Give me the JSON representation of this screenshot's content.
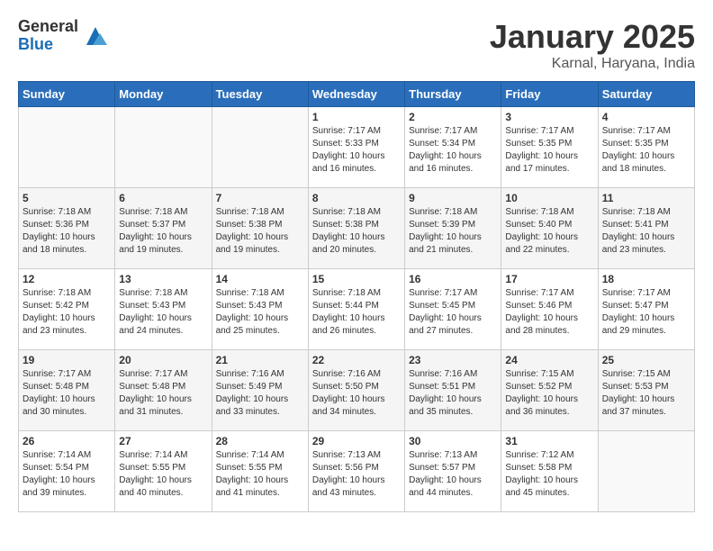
{
  "logo": {
    "general": "General",
    "blue": "Blue"
  },
  "header": {
    "month": "January 2025",
    "location": "Karnal, Haryana, India"
  },
  "weekdays": [
    "Sunday",
    "Monday",
    "Tuesday",
    "Wednesday",
    "Thursday",
    "Friday",
    "Saturday"
  ],
  "weeks": [
    [
      {
        "day": "",
        "sunrise": "",
        "sunset": "",
        "daylight": ""
      },
      {
        "day": "",
        "sunrise": "",
        "sunset": "",
        "daylight": ""
      },
      {
        "day": "",
        "sunrise": "",
        "sunset": "",
        "daylight": ""
      },
      {
        "day": "1",
        "sunrise": "Sunrise: 7:17 AM",
        "sunset": "Sunset: 5:33 PM",
        "daylight": "Daylight: 10 hours and 16 minutes."
      },
      {
        "day": "2",
        "sunrise": "Sunrise: 7:17 AM",
        "sunset": "Sunset: 5:34 PM",
        "daylight": "Daylight: 10 hours and 16 minutes."
      },
      {
        "day": "3",
        "sunrise": "Sunrise: 7:17 AM",
        "sunset": "Sunset: 5:35 PM",
        "daylight": "Daylight: 10 hours and 17 minutes."
      },
      {
        "day": "4",
        "sunrise": "Sunrise: 7:17 AM",
        "sunset": "Sunset: 5:35 PM",
        "daylight": "Daylight: 10 hours and 18 minutes."
      }
    ],
    [
      {
        "day": "5",
        "sunrise": "Sunrise: 7:18 AM",
        "sunset": "Sunset: 5:36 PM",
        "daylight": "Daylight: 10 hours and 18 minutes."
      },
      {
        "day": "6",
        "sunrise": "Sunrise: 7:18 AM",
        "sunset": "Sunset: 5:37 PM",
        "daylight": "Daylight: 10 hours and 19 minutes."
      },
      {
        "day": "7",
        "sunrise": "Sunrise: 7:18 AM",
        "sunset": "Sunset: 5:38 PM",
        "daylight": "Daylight: 10 hours and 19 minutes."
      },
      {
        "day": "8",
        "sunrise": "Sunrise: 7:18 AM",
        "sunset": "Sunset: 5:38 PM",
        "daylight": "Daylight: 10 hours and 20 minutes."
      },
      {
        "day": "9",
        "sunrise": "Sunrise: 7:18 AM",
        "sunset": "Sunset: 5:39 PM",
        "daylight": "Daylight: 10 hours and 21 minutes."
      },
      {
        "day": "10",
        "sunrise": "Sunrise: 7:18 AM",
        "sunset": "Sunset: 5:40 PM",
        "daylight": "Daylight: 10 hours and 22 minutes."
      },
      {
        "day": "11",
        "sunrise": "Sunrise: 7:18 AM",
        "sunset": "Sunset: 5:41 PM",
        "daylight": "Daylight: 10 hours and 23 minutes."
      }
    ],
    [
      {
        "day": "12",
        "sunrise": "Sunrise: 7:18 AM",
        "sunset": "Sunset: 5:42 PM",
        "daylight": "Daylight: 10 hours and 23 minutes."
      },
      {
        "day": "13",
        "sunrise": "Sunrise: 7:18 AM",
        "sunset": "Sunset: 5:43 PM",
        "daylight": "Daylight: 10 hours and 24 minutes."
      },
      {
        "day": "14",
        "sunrise": "Sunrise: 7:18 AM",
        "sunset": "Sunset: 5:43 PM",
        "daylight": "Daylight: 10 hours and 25 minutes."
      },
      {
        "day": "15",
        "sunrise": "Sunrise: 7:18 AM",
        "sunset": "Sunset: 5:44 PM",
        "daylight": "Daylight: 10 hours and 26 minutes."
      },
      {
        "day": "16",
        "sunrise": "Sunrise: 7:17 AM",
        "sunset": "Sunset: 5:45 PM",
        "daylight": "Daylight: 10 hours and 27 minutes."
      },
      {
        "day": "17",
        "sunrise": "Sunrise: 7:17 AM",
        "sunset": "Sunset: 5:46 PM",
        "daylight": "Daylight: 10 hours and 28 minutes."
      },
      {
        "day": "18",
        "sunrise": "Sunrise: 7:17 AM",
        "sunset": "Sunset: 5:47 PM",
        "daylight": "Daylight: 10 hours and 29 minutes."
      }
    ],
    [
      {
        "day": "19",
        "sunrise": "Sunrise: 7:17 AM",
        "sunset": "Sunset: 5:48 PM",
        "daylight": "Daylight: 10 hours and 30 minutes."
      },
      {
        "day": "20",
        "sunrise": "Sunrise: 7:17 AM",
        "sunset": "Sunset: 5:48 PM",
        "daylight": "Daylight: 10 hours and 31 minutes."
      },
      {
        "day": "21",
        "sunrise": "Sunrise: 7:16 AM",
        "sunset": "Sunset: 5:49 PM",
        "daylight": "Daylight: 10 hours and 33 minutes."
      },
      {
        "day": "22",
        "sunrise": "Sunrise: 7:16 AM",
        "sunset": "Sunset: 5:50 PM",
        "daylight": "Daylight: 10 hours and 34 minutes."
      },
      {
        "day": "23",
        "sunrise": "Sunrise: 7:16 AM",
        "sunset": "Sunset: 5:51 PM",
        "daylight": "Daylight: 10 hours and 35 minutes."
      },
      {
        "day": "24",
        "sunrise": "Sunrise: 7:15 AM",
        "sunset": "Sunset: 5:52 PM",
        "daylight": "Daylight: 10 hours and 36 minutes."
      },
      {
        "day": "25",
        "sunrise": "Sunrise: 7:15 AM",
        "sunset": "Sunset: 5:53 PM",
        "daylight": "Daylight: 10 hours and 37 minutes."
      }
    ],
    [
      {
        "day": "26",
        "sunrise": "Sunrise: 7:14 AM",
        "sunset": "Sunset: 5:54 PM",
        "daylight": "Daylight: 10 hours and 39 minutes."
      },
      {
        "day": "27",
        "sunrise": "Sunrise: 7:14 AM",
        "sunset": "Sunset: 5:55 PM",
        "daylight": "Daylight: 10 hours and 40 minutes."
      },
      {
        "day": "28",
        "sunrise": "Sunrise: 7:14 AM",
        "sunset": "Sunset: 5:55 PM",
        "daylight": "Daylight: 10 hours and 41 minutes."
      },
      {
        "day": "29",
        "sunrise": "Sunrise: 7:13 AM",
        "sunset": "Sunset: 5:56 PM",
        "daylight": "Daylight: 10 hours and 43 minutes."
      },
      {
        "day": "30",
        "sunrise": "Sunrise: 7:13 AM",
        "sunset": "Sunset: 5:57 PM",
        "daylight": "Daylight: 10 hours and 44 minutes."
      },
      {
        "day": "31",
        "sunrise": "Sunrise: 7:12 AM",
        "sunset": "Sunset: 5:58 PM",
        "daylight": "Daylight: 10 hours and 45 minutes."
      },
      {
        "day": "",
        "sunrise": "",
        "sunset": "",
        "daylight": ""
      }
    ]
  ]
}
